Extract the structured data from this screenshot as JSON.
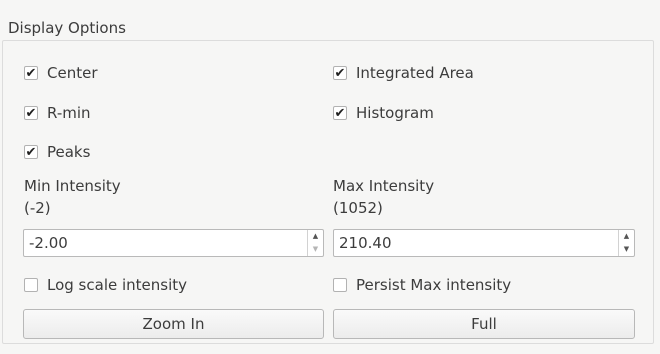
{
  "group": {
    "title": "Display Options"
  },
  "checkboxes": {
    "center": {
      "label": "Center",
      "checked": true
    },
    "integrated_area": {
      "label": "Integrated Area",
      "checked": true
    },
    "r_min": {
      "label": "R-min",
      "checked": true
    },
    "histogram": {
      "label": "Histogram",
      "checked": true
    },
    "peaks": {
      "label": "Peaks",
      "checked": true
    },
    "log_scale": {
      "label": "Log scale intensity",
      "checked": false
    },
    "persist_max": {
      "label": "Persist Max intensity",
      "checked": false
    }
  },
  "min_intensity": {
    "label": "Min Intensity",
    "hint": "(-2)",
    "value": "-2.00"
  },
  "max_intensity": {
    "label": "Max Intensity",
    "hint": "(1052)",
    "value": "210.40"
  },
  "buttons": {
    "zoom_in": "Zoom In",
    "full": "Full"
  },
  "icons": {
    "checkmark": "✔",
    "spin_up": "▲",
    "spin_down": "▼"
  }
}
